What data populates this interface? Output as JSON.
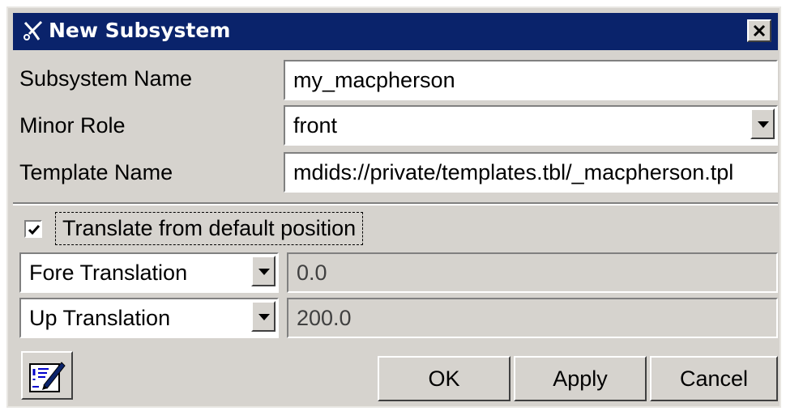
{
  "window": {
    "title": "New Subsystem",
    "icon": "scissors-icon",
    "close_label": "×"
  },
  "form": {
    "subsystem_name": {
      "label": "Subsystem Name",
      "value": "my_macpherson"
    },
    "minor_role": {
      "label": "Minor Role",
      "value": "front"
    },
    "template_name": {
      "label": "Template Name",
      "value": "mdids://private/templates.tbl/_macpherson.tpl"
    }
  },
  "translate": {
    "label": "Translate from default position",
    "checked": true
  },
  "translations": [
    {
      "axis": "Fore Translation",
      "value": "0.0"
    },
    {
      "axis": "Up Translation",
      "value": "200.0"
    }
  ],
  "buttons": {
    "ok": "OK",
    "apply": "Apply",
    "cancel": "Cancel"
  },
  "tool_icon": "edit-list-icon",
  "colors": {
    "titlebar": "#0a236b",
    "dialog_bg": "#d6d3ce"
  }
}
